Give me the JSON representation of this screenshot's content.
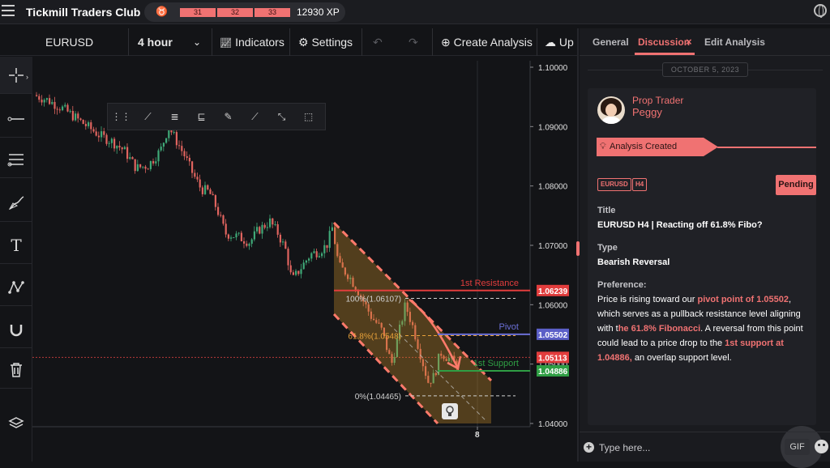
{
  "topbar": {
    "brand": "Tickmill Traders Club",
    "levels": [
      "31",
      "32",
      "33"
    ],
    "xp": "12930 XP"
  },
  "toolbar": {
    "symbol": "EURUSD",
    "timeframe": "4 hour",
    "indicators_label": "Indicators",
    "settings_label": "Settings",
    "create_label": "Create Analysis",
    "upload_label": "Up"
  },
  "chart": {
    "price_ticks": [
      "1.10000",
      "1.09000",
      "1.08000",
      "1.07000",
      "1.06000",
      "1.05000",
      "1.04000"
    ],
    "x_tick": "8",
    "levels": {
      "resistance": {
        "label": "1st Resistance",
        "price": "1.06239",
        "color": "#e23d3d"
      },
      "pivot": {
        "label": "Pivot",
        "price": "1.05502",
        "color": "#6b6fd6"
      },
      "current": {
        "price": "1.05113",
        "color": "#e23d3d"
      },
      "support": {
        "label": "1st Support",
        "price": "1.04886",
        "color": "#2f9e44"
      }
    },
    "fib": {
      "f100": "100%(1.06107)",
      "f618": "61.8%(1.0548)",
      "f0": "0%(1.04465)"
    }
  },
  "panel": {
    "tabs": [
      "General",
      "Discussion",
      "Edit Analysis"
    ],
    "tab_close": "×",
    "date": "OCTOBER 5, 2023",
    "author_role": "Prop Trader",
    "author_name": "Peggy",
    "status_label": "Analysis Created",
    "tags": [
      "EURUSD",
      "H4"
    ],
    "pending": "Pending",
    "title_label": "Title",
    "title_value": "EURUSD H4 | Reacting off 61.8% Fibo?",
    "type_label": "Type",
    "type_value": "Bearish Reversal",
    "pref_label": "Preference:",
    "pref_parts": {
      "a": "Price is rising toward our ",
      "b": "pivot point of 1.05502",
      "c": ", which serves as a pullback resistance level aligning with t",
      "d": "he 61.8% Fibonacci",
      "e": ". A reversal from this point could lead to a price drop to the ",
      "f": "1st support at 1.04886,",
      "g": "  an overlap support level."
    },
    "message_placeholder": "Type here...",
    "gif_label": "GIF"
  },
  "colors": {
    "accent": "#f07272",
    "candle_up": "#3fa877",
    "candle_down": "#e0645f",
    "channel": "#ff7a6b"
  }
}
